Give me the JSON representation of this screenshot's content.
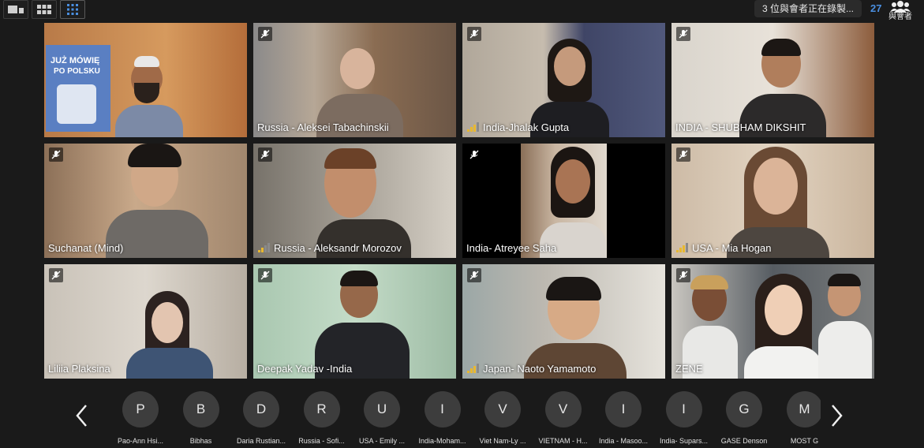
{
  "toolbar": {
    "recording_notice": "3 位與會者正在錄製...",
    "participant_count": "27",
    "participants_label": "與會者"
  },
  "tiles": [
    {
      "name": "",
      "muted": false,
      "signal": false
    },
    {
      "name": "Russia - Aleksei Tabachinskii",
      "muted": true,
      "signal": false
    },
    {
      "name": "India-Jhalak Gupta",
      "muted": true,
      "signal": true
    },
    {
      "name": "INDIA - SHUBHAM DIKSHIT",
      "muted": true,
      "signal": false
    },
    {
      "name": "Suchanat (Mind)",
      "muted": true,
      "signal": false
    },
    {
      "name": "Russia - Aleksandr Morozov",
      "muted": true,
      "signal": true
    },
    {
      "name": "India- Atreyee Saha",
      "muted": true,
      "signal": false
    },
    {
      "name": "USA - Mia Hogan",
      "muted": true,
      "signal": true
    },
    {
      "name": "Liliia Plaksina",
      "muted": true,
      "signal": false
    },
    {
      "name": "Deepak Yadav -India",
      "muted": true,
      "signal": false
    },
    {
      "name": "Japan- Naoto Yamamoto",
      "muted": true,
      "signal": true
    },
    {
      "name": "ZENE",
      "muted": true,
      "signal": false
    }
  ],
  "book_text": {
    "line1": "JUŻ MÓWIĘ",
    "line2": "PO POLSKU"
  },
  "strip": {
    "participants": [
      {
        "initial": "P",
        "name": "Pao-Ann Hsi..."
      },
      {
        "initial": "B",
        "name": "Bibhas"
      },
      {
        "initial": "D",
        "name": "Daria Rustian..."
      },
      {
        "initial": "R",
        "name": "Russia - Sofi..."
      },
      {
        "initial": "U",
        "name": "USA - Emily ..."
      },
      {
        "initial": "I",
        "name": "India-Moham..."
      },
      {
        "initial": "V",
        "name": "Viet Nam-Ly ..."
      },
      {
        "initial": "V",
        "name": "VIETNAM - H..."
      },
      {
        "initial": "I",
        "name": "India - Masoo..."
      },
      {
        "initial": "I",
        "name": "India- Supars..."
      },
      {
        "initial": "G",
        "name": "GASE Denson"
      },
      {
        "initial": "M",
        "name": "MOST G"
      }
    ]
  },
  "colors": {
    "accent": "#4a8fe0",
    "background": "#1a1a1a",
    "avatar": "#3d3d3d",
    "signal": "#e8b830"
  }
}
